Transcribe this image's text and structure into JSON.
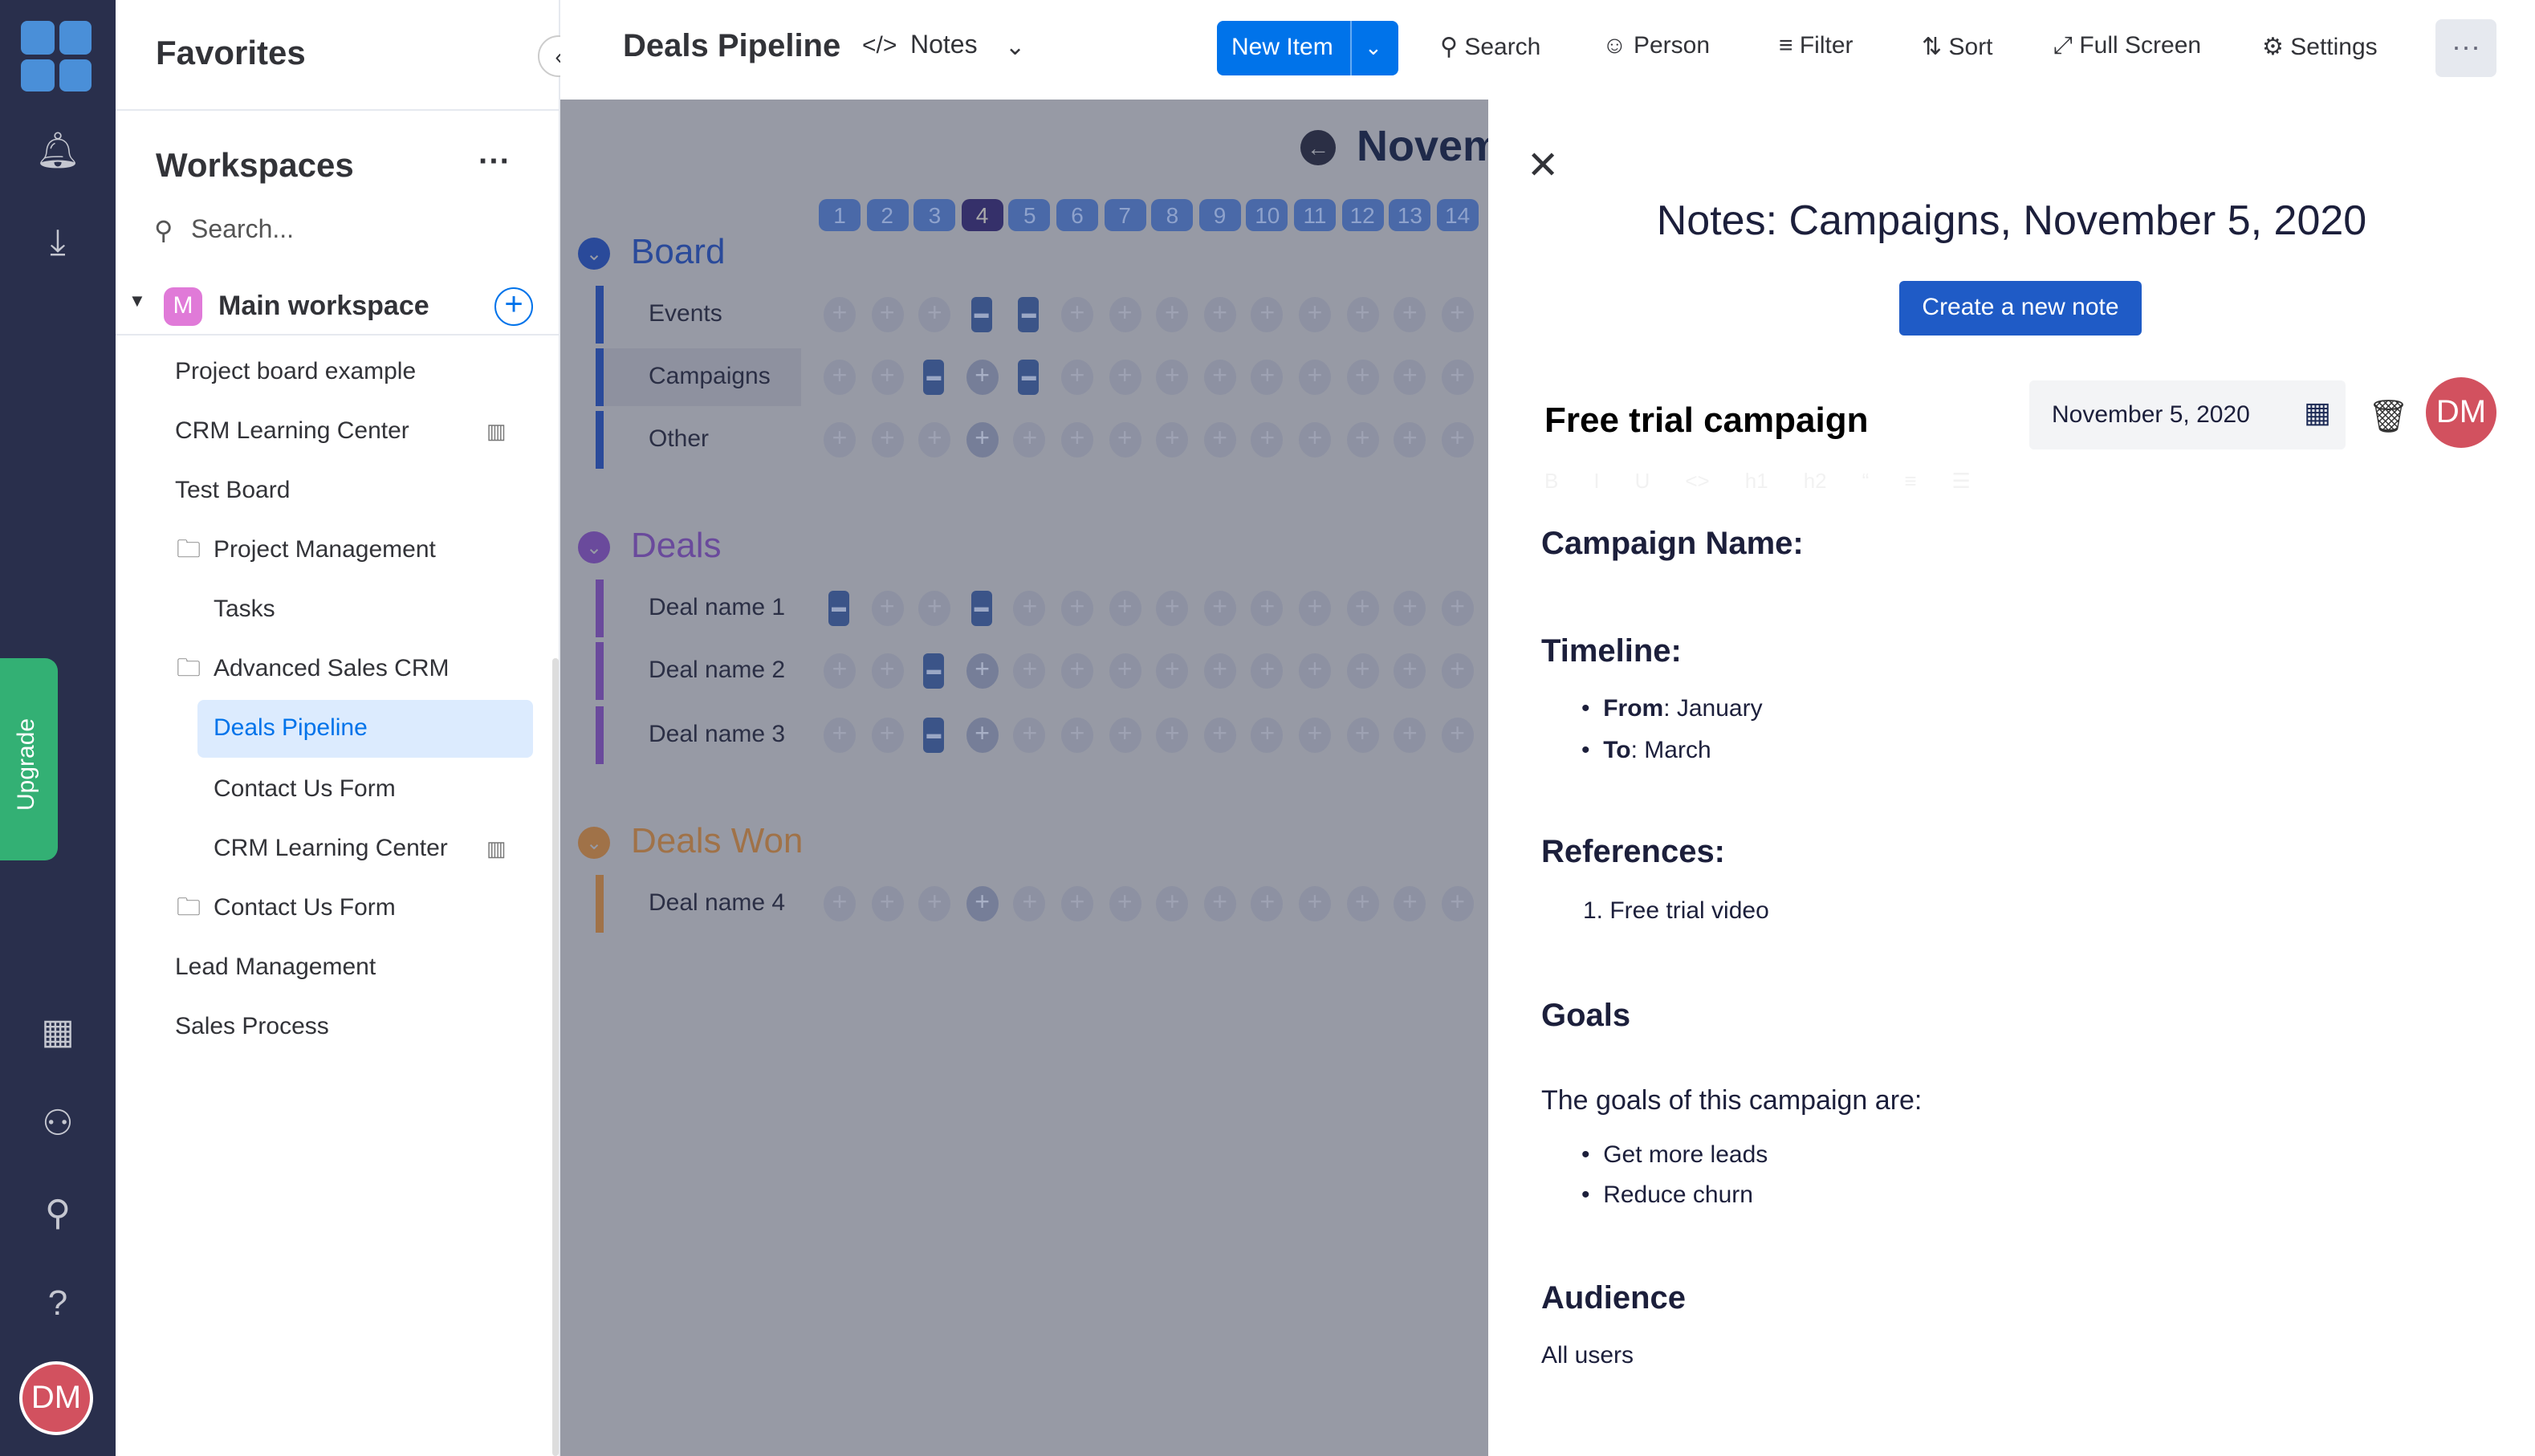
{
  "rail": {
    "upgrade": "Upgrade",
    "avatar": "DM",
    "icons": [
      "bell-icon",
      "download-icon",
      "calendar-check-icon",
      "add-person-icon",
      "search-icon",
      "help-icon"
    ]
  },
  "favorites": {
    "title": "Favorites",
    "workspaces_title": "Workspaces",
    "search_placeholder": "Search...",
    "workspace_name": "Main workspace",
    "workspace_initial": "M",
    "items": [
      {
        "label": "Project board example",
        "indent": 0,
        "folder": false
      },
      {
        "label": "CRM Learning Center",
        "indent": 0,
        "folder": false,
        "dash": true
      },
      {
        "label": "Test Board",
        "indent": 0,
        "folder": false
      },
      {
        "label": "Project Management",
        "indent": 0,
        "folder": true
      },
      {
        "label": "Tasks",
        "indent": 1,
        "folder": false
      },
      {
        "label": "Advanced Sales CRM",
        "indent": 0,
        "folder": true
      },
      {
        "label": "Deals Pipeline",
        "indent": 1,
        "folder": false,
        "selected": true
      },
      {
        "label": "Contact Us Form",
        "indent": 1,
        "folder": false
      },
      {
        "label": "CRM Learning Center",
        "indent": 1,
        "folder": false,
        "dash": true
      },
      {
        "label": "Contact Us Form",
        "indent": 0,
        "folder": true
      },
      {
        "label": "Lead Management",
        "indent": 0,
        "folder": false
      },
      {
        "label": "Sales Process",
        "indent": 0,
        "folder": false
      }
    ]
  },
  "toolbar": {
    "board_title": "Deals Pipeline",
    "view": "Notes",
    "new_item": "New Item",
    "search": "Search",
    "person": "Person",
    "filter": "Filter",
    "sort": "Sort",
    "fullscreen": "Full Screen",
    "settings": "Settings"
  },
  "calendar": {
    "month": "Novem",
    "days": [
      "1",
      "2",
      "3",
      "4",
      "5",
      "6",
      "7",
      "8",
      "9",
      "10",
      "11",
      "12",
      "13",
      "14"
    ],
    "today_index": 3,
    "groups": [
      {
        "name": "Board",
        "color": "#2a4a9a",
        "rows": [
          {
            "label": "Events",
            "cells": [
              "empty",
              "empty",
              "empty",
              "note",
              "note",
              "empty",
              "empty",
              "empty",
              "empty",
              "empty",
              "empty",
              "empty",
              "empty",
              "empty"
            ]
          },
          {
            "label": "Campaigns",
            "selected": true,
            "cells": [
              "empty",
              "empty",
              "note",
              "today",
              "note",
              "empty",
              "empty",
              "empty",
              "empty",
              "empty",
              "empty",
              "empty",
              "empty",
              "empty"
            ]
          },
          {
            "label": "Other",
            "cells": [
              "empty",
              "empty",
              "empty",
              "today",
              "empty",
              "empty",
              "empty",
              "empty",
              "empty",
              "empty",
              "empty",
              "empty",
              "empty",
              "empty"
            ]
          }
        ]
      },
      {
        "name": "Deals",
        "color": "#6a4a9c",
        "rows": [
          {
            "label": "Deal name 1",
            "cells": [
              "note",
              "empty",
              "empty",
              "note",
              "empty",
              "empty",
              "empty",
              "empty",
              "empty",
              "empty",
              "empty",
              "empty",
              "empty",
              "empty"
            ]
          },
          {
            "label": "Deal name 2",
            "cells": [
              "empty",
              "empty",
              "note",
              "today",
              "empty",
              "empty",
              "empty",
              "empty",
              "empty",
              "empty",
              "empty",
              "empty",
              "empty",
              "empty"
            ]
          },
          {
            "label": "Deal name 3",
            "cells": [
              "empty",
              "empty",
              "note",
              "today",
              "empty",
              "empty",
              "empty",
              "empty",
              "empty",
              "empty",
              "empty",
              "empty",
              "empty",
              "empty"
            ]
          }
        ]
      },
      {
        "name": "Deals Won",
        "color": "#a07248",
        "rows": [
          {
            "label": "Deal name 4",
            "cells": [
              "empty",
              "empty",
              "empty",
              "today",
              "empty",
              "empty",
              "empty",
              "empty",
              "empty",
              "empty",
              "empty",
              "empty",
              "empty",
              "empty"
            ]
          }
        ]
      }
    ]
  },
  "notes": {
    "title": "Notes: Campaigns, November 5, 2020",
    "create": "Create a new note",
    "note_title": "Free trial campaign",
    "date": "November 5, 2020",
    "avatar": "DM",
    "format_buttons": [
      "B",
      "I",
      "U",
      "<>",
      "h1",
      "h2",
      "“",
      "≡",
      "☰"
    ],
    "campaign_name": "Campaign Name:",
    "timeline": "Timeline:",
    "from_label": "From",
    "from_value": ": January",
    "to_label": "To",
    "to_value": ": March",
    "references": "References:",
    "ref1": "1. Free trial video",
    "goals": "Goals",
    "goals_intro": "The goals of this campaign are:",
    "goal1": "Get more leads",
    "goal2": "Reduce churn",
    "audience": "Audience",
    "audience_value": "All users"
  }
}
